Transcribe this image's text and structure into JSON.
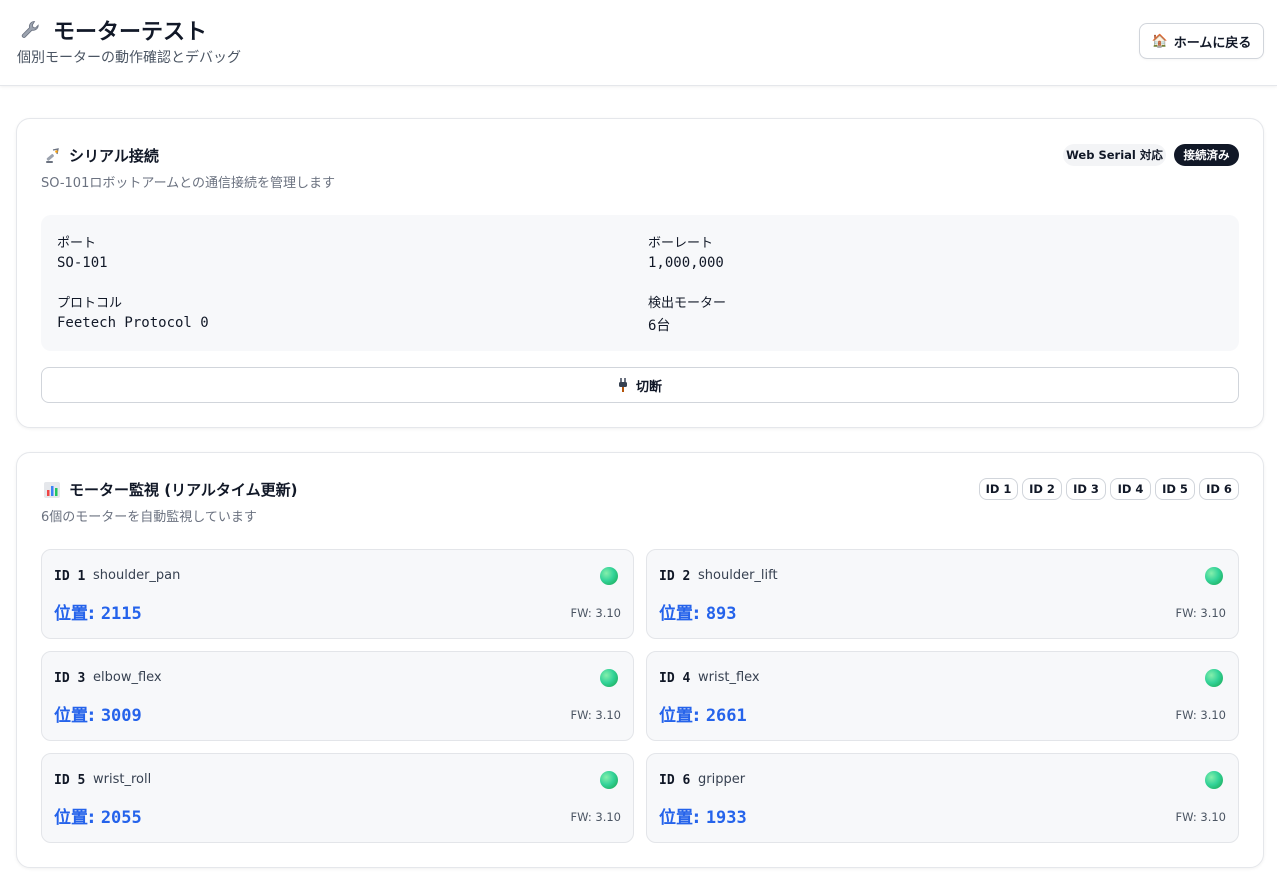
{
  "header": {
    "title": "モーターテスト",
    "subtitle": "個別モーターの動作確認とデバッグ",
    "home_button": "ホームに戻る",
    "home_icon": "🏠"
  },
  "serial": {
    "title": "シリアル接続",
    "description": "SO-101ロボットアームとの通信接続を管理します",
    "badge_support": "Web Serial 対応",
    "badge_status": "接続済み",
    "port_label": "ポート",
    "port_value": "SO-101",
    "baud_label": "ボーレート",
    "baud_value": "1,000,000",
    "protocol_label": "プロトコル",
    "protocol_value": "Feetech Protocol 0",
    "detected_label": "検出モーター",
    "detected_value": "6台",
    "disconnect_button": "切断"
  },
  "monitor": {
    "title": "モーター監視 (リアルタイム更新)",
    "description": "6個のモーターを自動監視しています",
    "chips": [
      "ID 1",
      "ID 2",
      "ID 3",
      "ID 4",
      "ID 5",
      "ID 6"
    ],
    "position_label": "位置:",
    "motors": [
      {
        "id": "ID 1",
        "name": "shoulder_pan",
        "position": "2115",
        "fw": "FW: 3.10"
      },
      {
        "id": "ID 2",
        "name": "shoulder_lift",
        "position": "893",
        "fw": "FW: 3.10"
      },
      {
        "id": "ID 3",
        "name": "elbow_flex",
        "position": "3009",
        "fw": "FW: 3.10"
      },
      {
        "id": "ID 4",
        "name": "wrist_flex",
        "position": "2661",
        "fw": "FW: 3.10"
      },
      {
        "id": "ID 5",
        "name": "wrist_roll",
        "position": "2055",
        "fw": "FW: 3.10"
      },
      {
        "id": "ID 6",
        "name": "gripper",
        "position": "1933",
        "fw": "FW: 3.10"
      }
    ]
  },
  "colors": {
    "accent_blue": "#2563eb",
    "status_green": "#34d399",
    "dark_badge": "#111827"
  }
}
